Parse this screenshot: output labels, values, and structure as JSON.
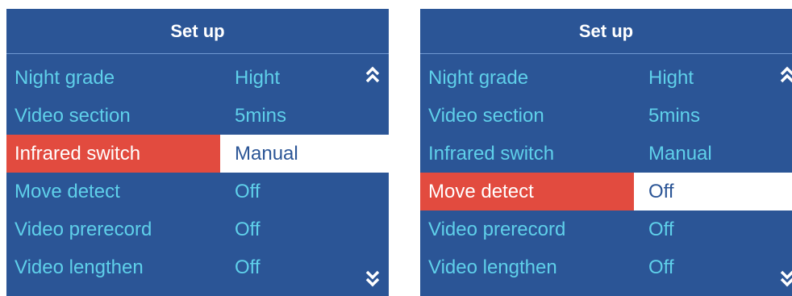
{
  "panels": [
    {
      "title": "Set up",
      "rows": [
        {
          "label": "Night grade",
          "value": "Hight",
          "selected": false
        },
        {
          "label": "Video section",
          "value": "5mins",
          "selected": false
        },
        {
          "label": "Infrared switch",
          "value": "Manual",
          "selected": true
        },
        {
          "label": "Move detect",
          "value": "Off",
          "selected": false
        },
        {
          "label": "Video prerecord",
          "value": "Off",
          "selected": false
        },
        {
          "label": "Video lengthen",
          "value": "Off",
          "selected": false
        }
      ]
    },
    {
      "title": "Set up",
      "rows": [
        {
          "label": "Night grade",
          "value": "Hight",
          "selected": false
        },
        {
          "label": "Video section",
          "value": "5mins",
          "selected": false
        },
        {
          "label": "Infrared switch",
          "value": "Manual",
          "selected": false
        },
        {
          "label": "Move detect",
          "value": "Off",
          "selected": true
        },
        {
          "label": "Video prerecord",
          "value": "Off",
          "selected": false
        },
        {
          "label": "Video lengthen",
          "value": "Off",
          "selected": false
        }
      ]
    }
  ],
  "icons": {
    "up": "double-chevron-up-icon",
    "down": "double-chevron-down-icon"
  },
  "colors": {
    "panel_bg": "#2b5596",
    "text": "#5fd0ea",
    "title": "#ffffff",
    "selected_label_bg": "#e24b3f",
    "selected_value_bg": "#ffffff"
  }
}
